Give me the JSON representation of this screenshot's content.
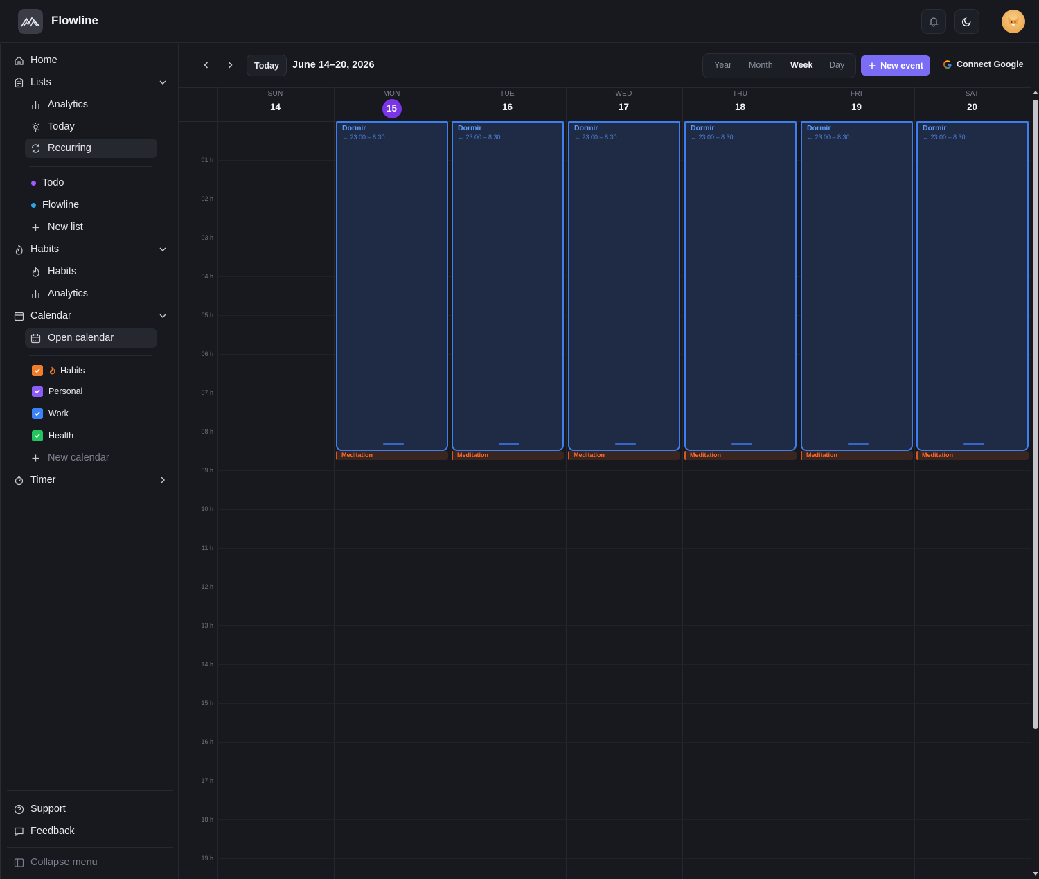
{
  "app": {
    "title": "Flowline"
  },
  "sidebar": {
    "home": "Home",
    "lists": {
      "label": "Lists",
      "items": [
        "Analytics",
        "Today",
        "Recurring"
      ],
      "user_lists": [
        {
          "label": "Todo",
          "color": "#a259ff"
        },
        {
          "label": "Flowline",
          "color": "#29a8e8"
        }
      ],
      "new_list": "New list"
    },
    "habits": {
      "label": "Habits",
      "items": [
        "Habits",
        "Analytics"
      ]
    },
    "calendar": {
      "label": "Calendar",
      "open": "Open calendar",
      "calendars": [
        {
          "label": "Habits",
          "color": "#f07d2a"
        },
        {
          "label": "Personal",
          "color": "#8b5cf6"
        },
        {
          "label": "Work",
          "color": "#3b82f6"
        },
        {
          "label": "Health",
          "color": "#22c55e"
        }
      ],
      "new_calendar": "New calendar"
    },
    "timer": "Timer",
    "support": "Support",
    "feedback": "Feedback",
    "collapse": "Collapse menu"
  },
  "toolbar": {
    "today": "Today",
    "range": "June 14–20, 2026",
    "views": [
      "Year",
      "Month",
      "Week",
      "Day"
    ],
    "selected_view": "Week",
    "new_event": "New event",
    "connect_google": "Connect Google"
  },
  "week": {
    "days": [
      {
        "name": "SUN",
        "num": "14",
        "today": false
      },
      {
        "name": "MON",
        "num": "15",
        "today": true
      },
      {
        "name": "TUE",
        "num": "16",
        "today": false
      },
      {
        "name": "WED",
        "num": "17",
        "today": false
      },
      {
        "name": "THU",
        "num": "18",
        "today": false
      },
      {
        "name": "FRI",
        "num": "19",
        "today": false
      },
      {
        "name": "SAT",
        "num": "20",
        "today": false
      }
    ],
    "hours": [
      "01 h",
      "02 h",
      "03 h",
      "04 h",
      "05 h",
      "06 h",
      "07 h",
      "08 h",
      "09 h",
      "10 h",
      "11 h",
      "12 h",
      "13 h",
      "14 h",
      "15 h",
      "16 h",
      "17 h",
      "18 h",
      "19 h"
    ],
    "sleep_event": {
      "title": "Dormir",
      "time": "← 23:00 – 8:30",
      "color": "#3b7ff0"
    },
    "meditation_event": {
      "title": "Meditation",
      "color": "#ff6a2a"
    }
  }
}
